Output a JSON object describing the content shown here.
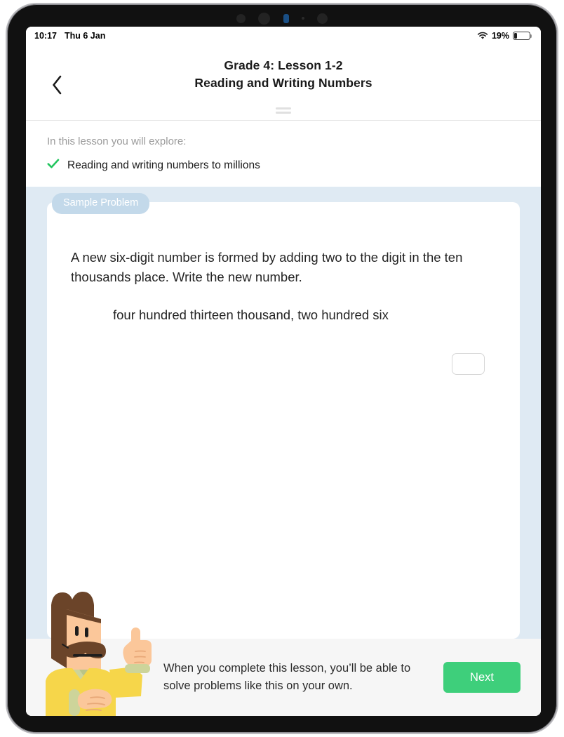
{
  "status_bar": {
    "time": "10:17",
    "date": "Thu 6 Jan",
    "battery_percent": "19%",
    "battery_level": 19,
    "wifi_icon": "wifi-icon",
    "battery_icon": "battery-icon"
  },
  "header": {
    "back_icon": "chevron-left-icon",
    "eyebrow": "Grade 4: Lesson 1-2",
    "title": "Reading and Writing Numbers",
    "drag_handle_icon": "drag-handle-icon"
  },
  "objectives": {
    "intro": "In this lesson you will explore:",
    "items": [
      {
        "check_icon": "check-icon",
        "label": "Reading and writing numbers to millions"
      }
    ]
  },
  "lesson": {
    "badge": "Sample Problem",
    "prompt": "A new six-digit number is formed by adding two to the digit in the ten thousands place. Write the new number.",
    "number_phrase": "four hundred thirteen thousand, two hundred six",
    "answer_value": "",
    "answer_placeholder": ""
  },
  "footer": {
    "message": "When you complete this lesson, you’ll be able to solve problems like this on your own.",
    "next_label": "Next",
    "mascot_icon": "mascot-pointing-icon"
  },
  "colors": {
    "lesson_background": "#dfeaf3",
    "badge_background": "#c3d9ea",
    "next_button": "#3ecf7b",
    "check_green": "#22c55e",
    "footer_background": "#f6f6f6"
  }
}
